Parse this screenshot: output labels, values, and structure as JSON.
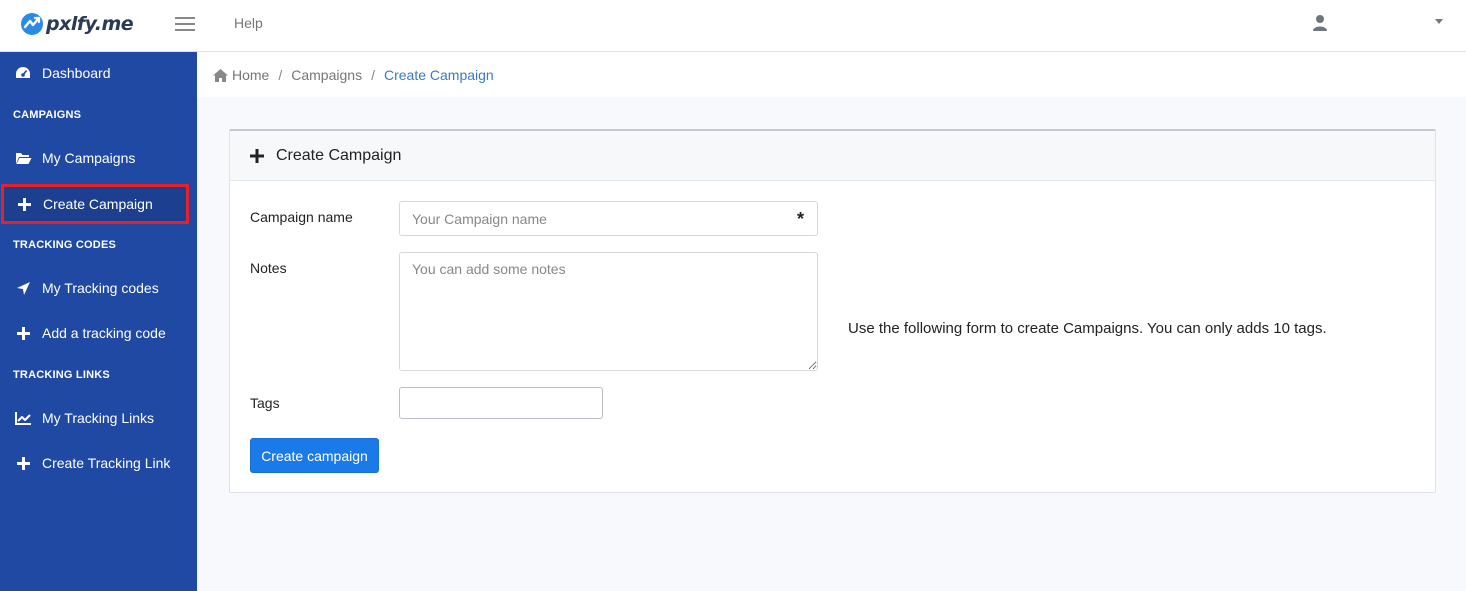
{
  "app": {
    "logo_text": "pxlfy.me"
  },
  "topbar": {
    "help_label": "Help"
  },
  "sidebar": {
    "items": [
      {
        "label": "Dashboard",
        "icon": "dashboard-gauge-icon"
      },
      {
        "section": "CAMPAIGNS"
      },
      {
        "label": "My Campaigns",
        "icon": "folder-open-icon"
      },
      {
        "label": "Create Campaign",
        "icon": "plus-icon",
        "active": true
      },
      {
        "section": "TRACKING CODES"
      },
      {
        "label": "My Tracking codes",
        "icon": "location-arrow-icon"
      },
      {
        "label": "Add a tracking code",
        "icon": "plus-icon"
      },
      {
        "section": "TRACKING LINKS"
      },
      {
        "label": "My Tracking Links",
        "icon": "line-chart-icon"
      },
      {
        "label": "Create Tracking Link",
        "icon": "plus-icon"
      }
    ]
  },
  "breadcrumb": {
    "home": "Home",
    "campaigns": "Campaigns",
    "current": "Create Campaign"
  },
  "form": {
    "title": "Create Campaign",
    "name_label": "Campaign name",
    "name_placeholder": "Your Campaign name",
    "required_marker": "*",
    "notes_label": "Notes",
    "notes_placeholder": "You can add some notes",
    "tags_label": "Tags",
    "tags_value": "",
    "submit_label": "Create campaign",
    "helper_text": "Use the following form to create Campaigns. You can only adds 10 tags."
  },
  "colors": {
    "sidebar_bg": "#2049a3",
    "primary_button": "#1a7be8",
    "active_outline": "#e8202a",
    "breadcrumb_active": "#3a7bbf"
  }
}
